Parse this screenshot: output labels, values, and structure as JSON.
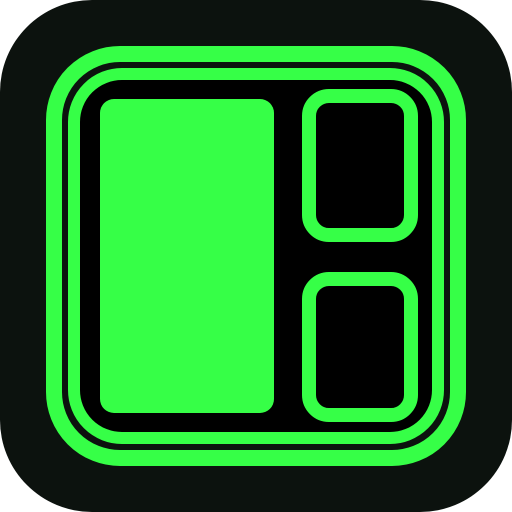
{
  "app_icon": {
    "icon_name": "layout-panels-icon",
    "colors": {
      "background": "#ffffff",
      "tile": "#0c120e",
      "accent": "#36ff47",
      "inner": "#000000"
    }
  }
}
